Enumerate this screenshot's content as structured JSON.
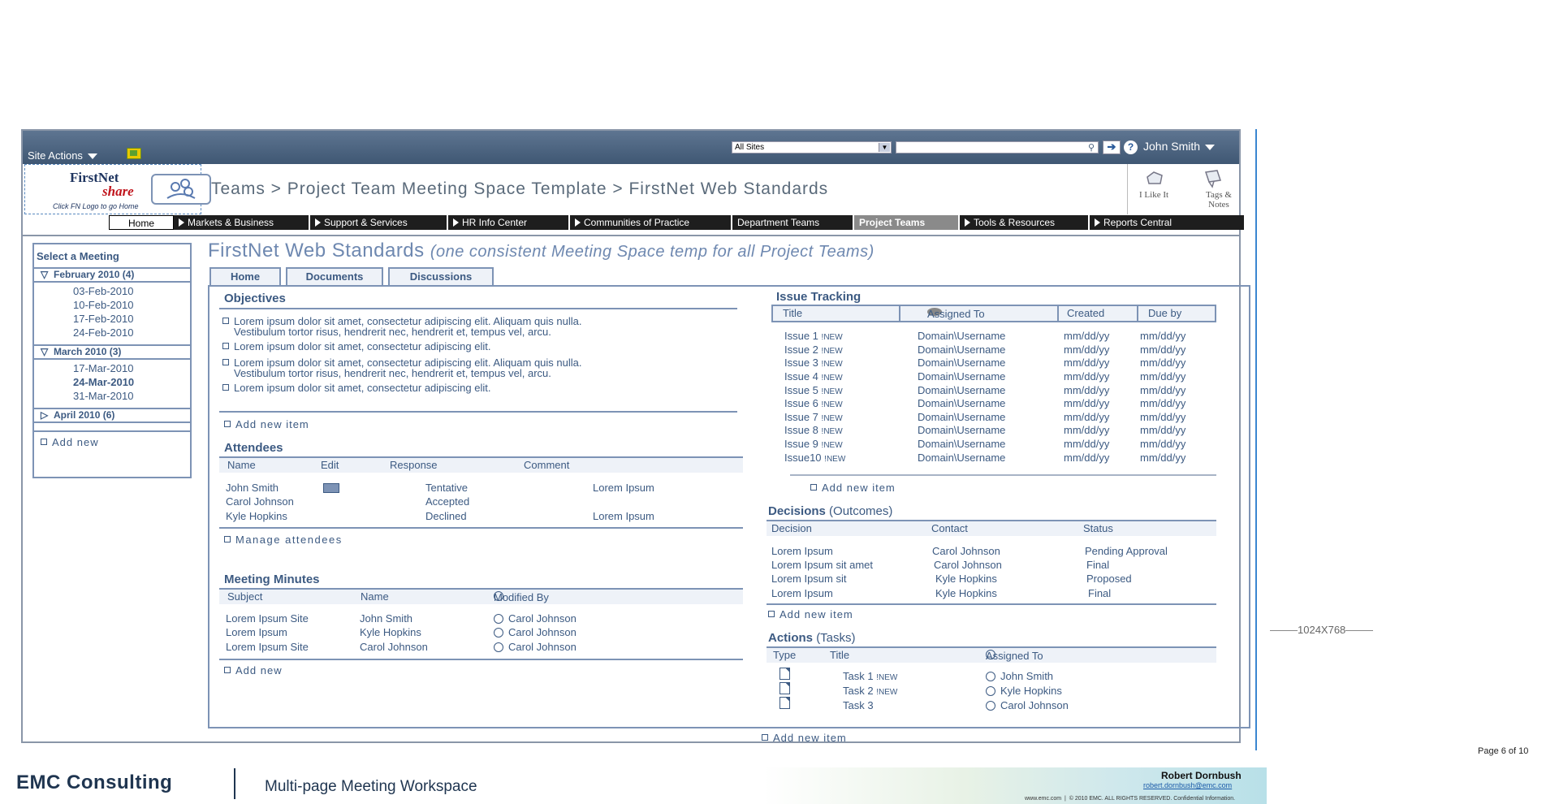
{
  "topbar": {
    "site_actions": "Site Actions",
    "scope": "All Sites",
    "search_value": "",
    "user": "John Smith"
  },
  "logo": {
    "line1": "FirstNet",
    "line2": "share",
    "caption": "Click FN Logo to go Home"
  },
  "breadcrumb": "Teams > Project Team Meeting Space Template > FirstNet Web Standards",
  "social": {
    "like": "I Like It",
    "tags_line1": "Tags &",
    "tags_line2": "Notes"
  },
  "nav": [
    "Home",
    "Markets & Business",
    "Support & Services",
    "HR Info Center",
    "Communities of Practice",
    "Department Teams",
    "Project Teams",
    "Tools & Resources",
    "Reports Central"
  ],
  "sidebar": {
    "title": "Select a Meeting",
    "groups": [
      {
        "label": "February 2010 (4)",
        "dates": [
          "03-Feb-2010",
          "10-Feb-2010",
          "17-Feb-2010",
          "24-Feb-2010"
        ]
      },
      {
        "label": "March 2010 (3)",
        "dates": [
          "17-Mar-2010",
          "24-Mar-2010",
          "31-Mar-2010"
        ]
      },
      {
        "label": "April 2010 (6)",
        "dates": []
      }
    ],
    "add_new": "Add new"
  },
  "page": {
    "title": "FirstNet Web Standards",
    "subtitle": "(one consistent Meeting Space temp for all Project Teams)"
  },
  "tabs": [
    "Home",
    "Documents",
    "Discussions"
  ],
  "objectives": {
    "title": "Objectives",
    "items": [
      [
        "Lorem ipsum dolor sit amet, consectetur adipiscing elit. Aliquam quis nulla.",
        "Vestibulum tortor risus, hendrerit nec, hendrerit et, tempus vel, arcu."
      ],
      [
        "Lorem ipsum dolor sit amet, consectetur adipiscing elit."
      ],
      [
        "Lorem ipsum dolor sit amet, consectetur adipiscing elit. Aliquam quis nulla.",
        "Vestibulum tortor risus, hendrerit nec, hendrerit et, tempus vel, arcu."
      ],
      [
        "Lorem ipsum dolor sit amet, consectetur adipiscing elit."
      ]
    ],
    "add": "Add new item"
  },
  "attendees": {
    "title": "Attendees",
    "columns": [
      "Name",
      "Edit",
      "Response",
      "Comment"
    ],
    "rows": [
      {
        "name": "John Smith",
        "response": "Tentative",
        "comment": "Lorem Ipsum"
      },
      {
        "name": "Carol Johnson",
        "response": "Accepted",
        "comment": ""
      },
      {
        "name": "Kyle Hopkins",
        "response": "Declined",
        "comment": "Lorem Ipsum"
      }
    ],
    "manage": "Manage attendees"
  },
  "minutes": {
    "title": "Meeting Minutes",
    "columns": [
      "Subject",
      "Name",
      "Modified By"
    ],
    "rows": [
      [
        "Lorem Ipsum Site",
        "John Smith",
        "Carol Johnson"
      ],
      [
        "Lorem Ipsum",
        "Kyle Hopkins",
        "Carol Johnson"
      ],
      [
        "Lorem Ipsum Site",
        "Carol Johnson",
        "Carol Johnson"
      ]
    ],
    "add": "Add new"
  },
  "issues": {
    "title": "Issue Tracking",
    "columns": [
      "Title",
      "Assigned To",
      "Created",
      "Due by"
    ],
    "rows": [
      [
        "Issue 1",
        "Domain\\Username",
        "mm/dd/yy",
        "mm/dd/yy"
      ],
      [
        "Issue 2",
        "Domain\\Username",
        "mm/dd/yy",
        "mm/dd/yy"
      ],
      [
        "Issue 3",
        "Domain\\Username",
        "mm/dd/yy",
        "mm/dd/yy"
      ],
      [
        "Issue 4",
        "Domain\\Username",
        "mm/dd/yy",
        "mm/dd/yy"
      ],
      [
        "Issue 5",
        "Domain\\Username",
        "mm/dd/yy",
        "mm/dd/yy"
      ],
      [
        "Issue 6",
        "Domain\\Username",
        "mm/dd/yy",
        "mm/dd/yy"
      ],
      [
        "Issue 7",
        "Domain\\Username",
        "mm/dd/yy",
        "mm/dd/yy"
      ],
      [
        "Issue 8",
        "Domain\\Username",
        "mm/dd/yy",
        "mm/dd/yy"
      ],
      [
        "Issue 9",
        "Domain\\Username",
        "mm/dd/yy",
        "mm/dd/yy"
      ],
      [
        "Issue10",
        "Domain\\Username",
        "mm/dd/yy",
        "mm/dd/yy"
      ]
    ],
    "new_badge": "!NEW",
    "add": "Add new item"
  },
  "decisions": {
    "title": "Decisions",
    "title_suffix": "(Outcomes)",
    "columns": [
      "Decision",
      "Contact",
      "Status"
    ],
    "rows": [
      [
        "Lorem Ipsum",
        "Carol Johnson",
        "Pending Approval"
      ],
      [
        "Lorem Ipsum sit amet",
        "Carol Johnson",
        "Final"
      ],
      [
        "Lorem Ipsum sit",
        "Kyle Hopkins",
        "Proposed"
      ],
      [
        "Lorem Ipsum",
        "Kyle Hopkins",
        "Final"
      ]
    ],
    "add": "Add new item"
  },
  "actions": {
    "title": "Actions",
    "title_suffix": "(Tasks)",
    "columns": [
      "Type",
      "Title",
      "Assigned To"
    ],
    "rows": [
      {
        "title": "Task 1",
        "new": true,
        "assigned": "John Smith"
      },
      {
        "title": "Task 2",
        "new": true,
        "assigned": "Kyle Hopkins"
      },
      {
        "title": "Task 3",
        "new": false,
        "assigned": "Carol Johnson"
      }
    ],
    "add": "Add new item"
  },
  "annotation": {
    "resolution": "1024X768",
    "page": "Page 6 of 10"
  },
  "footer": {
    "company": "EMC Consulting",
    "doc_title": "Multi-page Meeting Workspace",
    "author": "Robert Dornbush",
    "email": "robert.dornbush@emc.com",
    "url": "www.emc.com",
    "copyright": "© 2010 EMC. ALL RIGHTS RESERVED. Confidential Information."
  },
  "colors": {
    "accent": "#3c5a82",
    "border": "#7d93b5",
    "header_bg": "#4a6280"
  }
}
